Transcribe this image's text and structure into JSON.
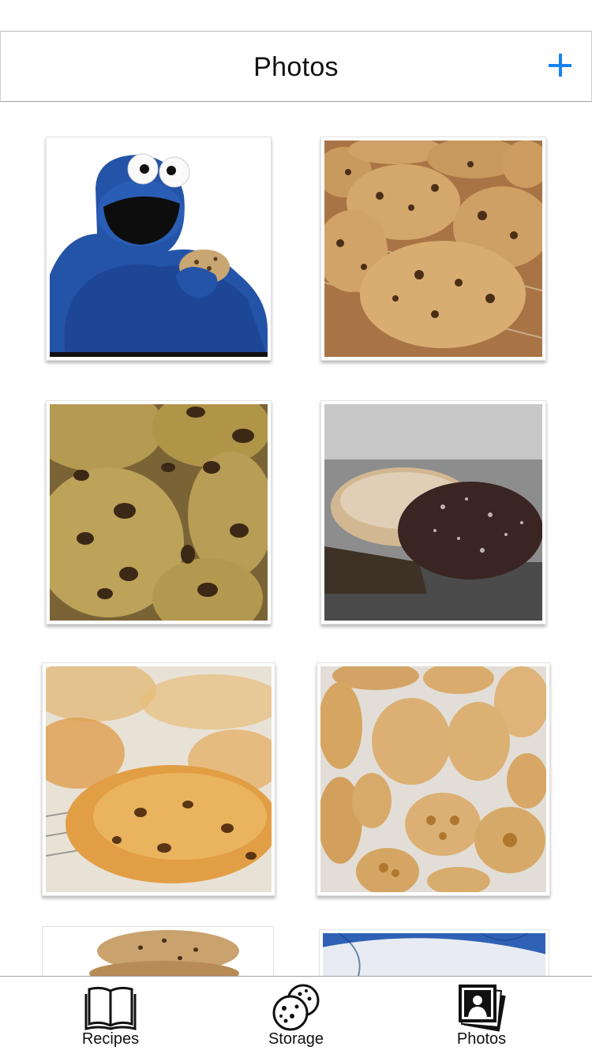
{
  "nav": {
    "title": "Photos",
    "add_icon": "plus-icon"
  },
  "colors": {
    "accent": "#1a82f0"
  },
  "photos": [
    {
      "subject": "cookie-monster"
    },
    {
      "subject": "chocolate-chip-cookies-on-rack"
    },
    {
      "subject": "chocolate-chip-cookies-closeup"
    },
    {
      "subject": "double-chocolate-cookies"
    },
    {
      "subject": "golden-cookie-on-rack"
    },
    {
      "subject": "butter-cookies-in-cups"
    },
    {
      "subject": "stacked-cookies"
    },
    {
      "subject": "cookies-on-blue-plate"
    }
  ],
  "tabs": [
    {
      "label": "Recipes",
      "icon": "book-icon"
    },
    {
      "label": "Storage",
      "icon": "cookies-icon"
    },
    {
      "label": "Photos",
      "icon": "photo-stack-icon",
      "selected": true
    }
  ]
}
